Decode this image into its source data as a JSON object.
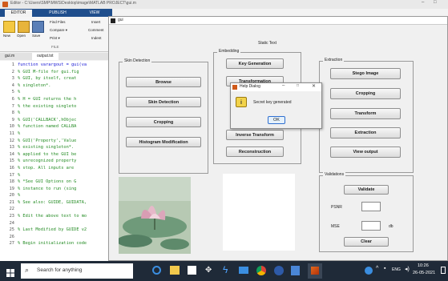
{
  "editor_window": {
    "title": "Editor - C:\\Users\\SMP\\MWS\\Desktop\\image\\MATLAB PROJECT\\gui.m",
    "ribbon_tabs": [
      "EDITOR",
      "PUBLISH",
      "VIEW"
    ],
    "file_buttons": {
      "new": "New",
      "open": "Open",
      "save": "Save"
    },
    "find_files": "Find Files",
    "compare": "Compare ▾",
    "print": "Print ▾",
    "insert": "Insert",
    "comment": "Comment",
    "indent": "Indent",
    "file_section": "FILE",
    "file_tabs": [
      "gui.m",
      "output.txt"
    ],
    "code_lines": [
      {
        "n": "1",
        "text": "function varargout = gui(va"
      },
      {
        "n": "2",
        "text": "% GUI M-file for gui.fig"
      },
      {
        "n": "3",
        "text": "%      GUI, by itself, creat"
      },
      {
        "n": "4",
        "text": "%      singleton*."
      },
      {
        "n": "5",
        "text": "%"
      },
      {
        "n": "6",
        "text": "%      H = GUI returns the h"
      },
      {
        "n": "7",
        "text": "%      the existing singleto"
      },
      {
        "n": "8",
        "text": "%"
      },
      {
        "n": "9",
        "text": "%      GUI('CALLBACK',hObjec"
      },
      {
        "n": "10",
        "text": "%      function named CALLBA"
      },
      {
        "n": "11",
        "text": "%"
      },
      {
        "n": "12",
        "text": "%      GUI('Property','Value"
      },
      {
        "n": "13",
        "text": "%      existing singleton*."
      },
      {
        "n": "14",
        "text": "%      applied to the GUI be"
      },
      {
        "n": "15",
        "text": "%      unrecognized property"
      },
      {
        "n": "16",
        "text": "%      stop.  All inputs are"
      },
      {
        "n": "17",
        "text": "%"
      },
      {
        "n": "18",
        "text": "%      *See GUI Options on G"
      },
      {
        "n": "19",
        "text": "%      instance to run (sing"
      },
      {
        "n": "20",
        "text": "%"
      },
      {
        "n": "21",
        "text": "% See also: GUIDE, GUIDATA,"
      },
      {
        "n": "22",
        "text": ""
      },
      {
        "n": "23",
        "text": "% Edit the above text to mo"
      },
      {
        "n": "24",
        "text": ""
      },
      {
        "n": "25",
        "text": "% Last Modified by GUIDE v2"
      },
      {
        "n": "26",
        "text": ""
      },
      {
        "n": "27",
        "text": "% Begin initialization code"
      }
    ]
  },
  "gui_figure": {
    "title": "gui",
    "static_text": "Static Text",
    "skin_panel": {
      "title": "Skin Detection",
      "buttons": [
        "Browse",
        "Skin Detection",
        "Cropping",
        "Histogram Modification"
      ]
    },
    "embed_panel": {
      "title": "Embedding",
      "buttons": [
        "Key Generation",
        "Transformation",
        "Inverse Transform",
        "Reconstruction"
      ]
    },
    "extract_panel": {
      "title": "Extraction",
      "buttons": [
        "Stego Image",
        "Cropping",
        "Transform",
        "Extraction",
        "View output"
      ]
    },
    "valid_panel": {
      "title": "Validations",
      "validate": "Validate",
      "psnr": "PSNR",
      "mse": "MSE",
      "db": "db",
      "clear": "Clear"
    }
  },
  "help_dialog": {
    "title": "Help Dialog",
    "message": "Secret key generated",
    "ok": "OK"
  },
  "taskbar": {
    "search_placeholder": "Search for anything",
    "time": "10:26",
    "date": "26-05-2021",
    "lang": "ENG"
  },
  "colors": {
    "editor_bg": "#ffffff",
    "comment": "#228b22",
    "figure_bg": "#f0f0f0",
    "taskbar_bg": "#1f2a38",
    "window_chrome": "#e9e9e9"
  }
}
